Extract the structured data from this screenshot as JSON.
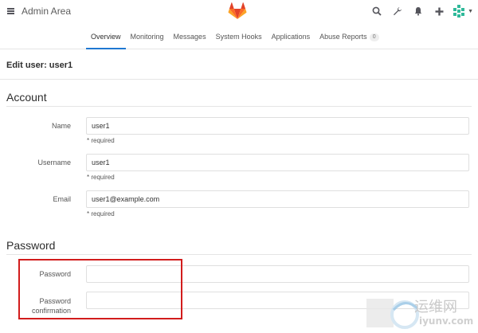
{
  "header": {
    "title": "Admin Area",
    "icons": [
      "menu-icon",
      "gitlab-logo",
      "search-icon",
      "wrench-icon",
      "bell-icon",
      "plus-icon",
      "avatar",
      "caret-down-icon"
    ]
  },
  "subnav": {
    "tabs": [
      {
        "label": "Overview",
        "active": true
      },
      {
        "label": "Monitoring",
        "active": false
      },
      {
        "label": "Messages",
        "active": false
      },
      {
        "label": "System Hooks",
        "active": false
      },
      {
        "label": "Applications",
        "active": false
      },
      {
        "label": "Abuse Reports",
        "active": false,
        "badge": "0"
      }
    ]
  },
  "page": {
    "title": "Edit user: user1"
  },
  "account": {
    "heading": "Account",
    "name": {
      "label": "Name",
      "value": "user1",
      "help": "* required"
    },
    "username": {
      "label": "Username",
      "value": "user1",
      "help": "* required"
    },
    "email": {
      "label": "Email",
      "value": "user1@example.com",
      "help": "* required"
    }
  },
  "password": {
    "heading": "Password",
    "password": {
      "label": "Password",
      "value": ""
    },
    "confirmation": {
      "label": "Password confirmation",
      "value": ""
    }
  },
  "watermark": {
    "text": "运维网",
    "url": "iyunv.com"
  },
  "colors": {
    "accent": "#1f78d1",
    "highlight": "#d21c1c",
    "logo_orange": "#fc6d26",
    "logo_red": "#e24329",
    "logo_light": "#fca326"
  }
}
